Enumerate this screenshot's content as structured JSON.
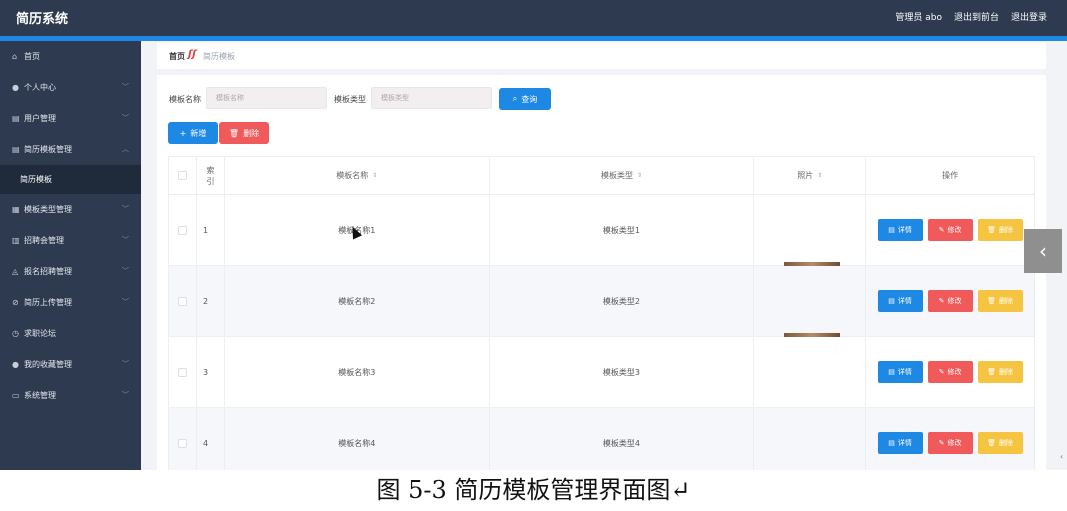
{
  "header": {
    "app_title": "简历系统",
    "user_label": "管理员 abo",
    "to_frontend": "退出到前台",
    "logout": "退出登录"
  },
  "sidebar": {
    "items": [
      {
        "icon": "home-icon",
        "glyph": "⌂",
        "label": "首页",
        "chevron": false
      },
      {
        "icon": "user-icon",
        "glyph": "●",
        "label": "个人中心",
        "chevron": true
      },
      {
        "icon": "users-icon",
        "glyph": "▤",
        "label": "用户管理",
        "chevron": true
      },
      {
        "icon": "template-icon",
        "glyph": "▤",
        "label": "简历模板管理",
        "chevron": true,
        "expanded": true
      },
      {
        "icon": "sub",
        "glyph": "",
        "label": "简历模板",
        "sub": true
      },
      {
        "icon": "category-icon",
        "glyph": "▦",
        "label": "模板类型管理",
        "chevron": true
      },
      {
        "icon": "fair-icon",
        "glyph": "▥",
        "label": "招聘会管理",
        "chevron": true
      },
      {
        "icon": "signup-icon",
        "glyph": "◬",
        "label": "报名招聘管理",
        "chevron": true
      },
      {
        "icon": "upload-icon",
        "glyph": "⊘",
        "label": "简历上传管理",
        "chevron": true
      },
      {
        "icon": "forum-icon",
        "glyph": "◷",
        "label": "求职论坛",
        "chevron": false
      },
      {
        "icon": "favorite-icon",
        "glyph": "●",
        "label": "我的收藏管理",
        "chevron": true
      },
      {
        "icon": "system-icon",
        "glyph": "▭",
        "label": "系统管理",
        "chevron": true
      }
    ]
  },
  "breadcrumb": {
    "home": "首页",
    "current": "简历模板"
  },
  "filters": {
    "name_label": "模板名称",
    "name_placeholder": "模板名称",
    "type_label": "模板类型",
    "type_placeholder": "模板类型",
    "query_button": "查询"
  },
  "actions": {
    "add": "新增",
    "delete": "删除"
  },
  "table": {
    "headers": {
      "index_line1": "索",
      "index_line2": "引",
      "name": "模板名称",
      "type": "模板类型",
      "photo": "照片",
      "ops": "操作"
    },
    "rows": [
      {
        "index": "1",
        "name": "模板名称1",
        "type": "模板类型1",
        "has_photo": false
      },
      {
        "index": "2",
        "name": "模板名称2",
        "type": "模板类型2",
        "has_photo": true
      },
      {
        "index": "3",
        "name": "模板名称3",
        "type": "模板类型3",
        "has_photo": true
      },
      {
        "index": "4",
        "name": "模板名称4",
        "type": "模板类型4",
        "has_photo": false
      }
    ],
    "op_labels": {
      "detail": "详情",
      "edit": "修改",
      "delete": "删除"
    }
  },
  "side_tab": {
    "glyph": "‹"
  },
  "caption": "图 5-3 简历模板管理界面图↵",
  "colors": {
    "primary": "#1e88e5",
    "danger": "#f05a5a",
    "warning": "#f5c542",
    "sidebar": "#2d3a4f"
  }
}
